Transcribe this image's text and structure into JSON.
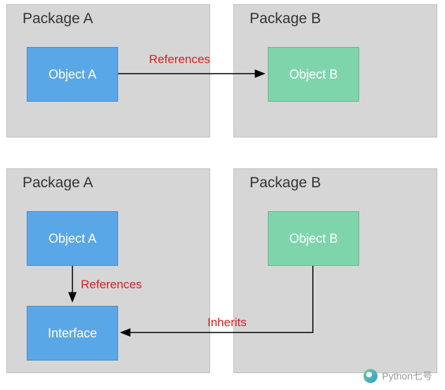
{
  "diagram": {
    "top": {
      "packageA": {
        "title": "Package A",
        "object": "Object A"
      },
      "packageB": {
        "title": "Package B",
        "object": "Object B"
      },
      "arrowLabel": "References"
    },
    "bottom": {
      "packageA": {
        "title": "Package A",
        "object": "Object A",
        "interface": "Interface"
      },
      "packageB": {
        "title": "Package B",
        "object": "Object B"
      },
      "refLabel": "References",
      "inheritLabel": "Inherits"
    }
  },
  "watermark": "Python七号"
}
